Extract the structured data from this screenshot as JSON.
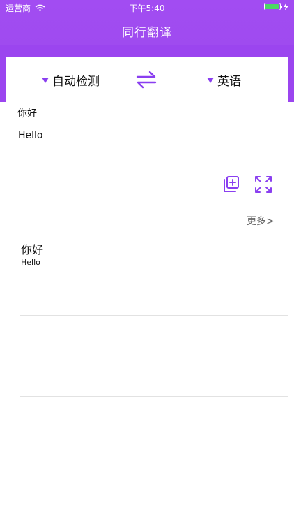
{
  "status_bar": {
    "carrier": "运营商",
    "time": "下午5:40",
    "battery_level": 0.88
  },
  "nav": {
    "title": "同行翻译"
  },
  "languages": {
    "source": "自动检测",
    "target": "英语"
  },
  "translation": {
    "input": "你好",
    "output": "Hello"
  },
  "more_label": "更多>",
  "history": [
    {
      "source": "你好",
      "target": "Hello"
    },
    {
      "source": "",
      "target": ""
    },
    {
      "source": "",
      "target": ""
    },
    {
      "source": "",
      "target": ""
    },
    {
      "source": "",
      "target": ""
    }
  ],
  "colors": {
    "accent": "#9b45ef",
    "icon": "#8a3ff0"
  }
}
